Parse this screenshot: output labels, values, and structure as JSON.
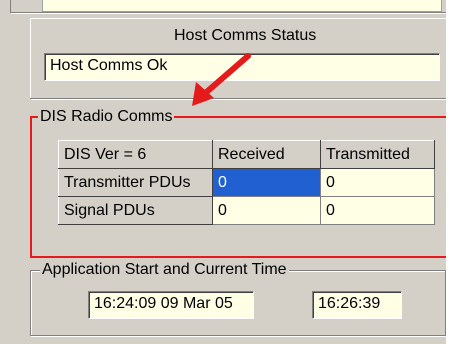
{
  "host_comms": {
    "title": "Host Comms Status",
    "status_value": "Host Comms Ok"
  },
  "dis_radio": {
    "title": "DIS Radio Comms",
    "table": {
      "headers": [
        "DIS Ver = 6",
        "Received",
        "Transmitted"
      ],
      "rows": [
        {
          "label": "Transmitter PDUs",
          "received": "0",
          "transmitted": "0"
        },
        {
          "label": "Signal PDUs",
          "received": "0",
          "transmitted": "0"
        }
      ]
    },
    "highlight_color": "#e51a1a",
    "selected_cell_color": "#2060d0"
  },
  "app_time": {
    "title": "Application Start and Current Time",
    "start_time": "16:24:09 09 Mar 05",
    "current_time": "16:26:39"
  },
  "icons": [
    "red-arrow-icon"
  ]
}
